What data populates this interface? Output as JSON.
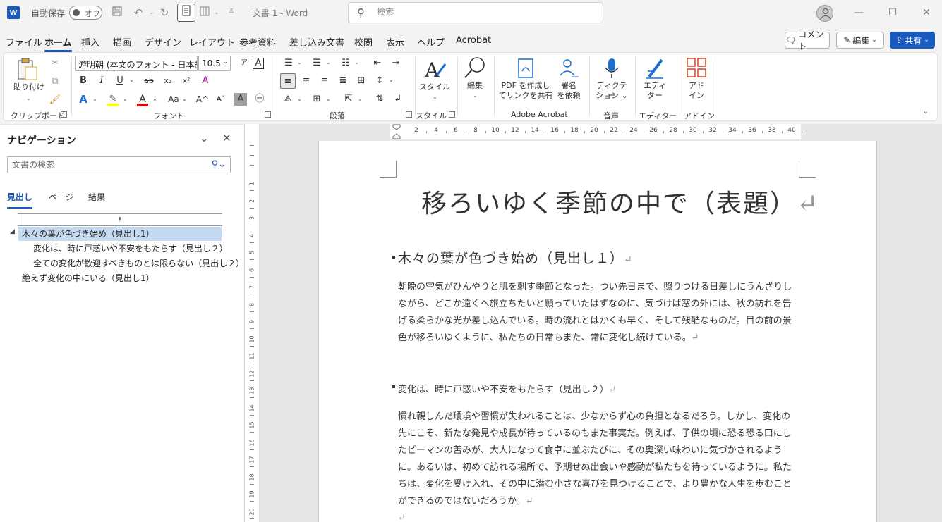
{
  "titlebar": {
    "app_icon_letter": "W",
    "autosave_label": "自動保存",
    "autosave_state": "オフ",
    "doc_title": "文書 1 - Word",
    "search_placeholder": "検索",
    "undo_icon": "undo-icon",
    "redo_icon": "redo-icon"
  },
  "menu": {
    "tabs": [
      "ファイル",
      "ホーム",
      "挿入",
      "描画",
      "デザイン",
      "レイアウト",
      "参考資料",
      "差し込み文書",
      "校閲",
      "表示",
      "ヘルプ",
      "Acrobat"
    ],
    "active": "ホーム",
    "comment_label": "コメント",
    "edit_label": "編集",
    "share_label": "共有"
  },
  "ribbon": {
    "clipboard": {
      "paste_label": "貼り付け",
      "group_label": "クリップボード"
    },
    "font": {
      "font_name": "游明朝 (本文のフォント - 日本語)",
      "font_size": "10.5",
      "group_label": "フォント",
      "bold": "B",
      "italic": "I",
      "underline": "U",
      "strike": "ab",
      "sub": "x₂",
      "sup": "x²",
      "case": "Aa",
      "grow": "A^",
      "shrink": "Aˇ"
    },
    "paragraph": {
      "group_label": "段落"
    },
    "styles": {
      "label": "スタイル",
      "group_label": "スタイル"
    },
    "editing": {
      "label": "編集"
    },
    "acrobat": {
      "pdf_label_1": "PDF を作成し",
      "pdf_label_2": "てリンクを共有",
      "sign_label_1": "署名",
      "sign_label_2": "を依頼",
      "group_label": "Adobe Acrobat"
    },
    "voice": {
      "label_1": "ディクテー",
      "label_2": "ション",
      "group_label": "音声"
    },
    "editor": {
      "label_1": "エディ",
      "label_2": "ター",
      "group_label": "エディター"
    },
    "addins": {
      "label_1": "アド",
      "label_2": "イン",
      "group_label": "アドイン"
    }
  },
  "nav": {
    "title": "ナビゲーション",
    "search_placeholder": "文書の検索",
    "tabs": [
      "見出し",
      "ページ",
      "結果"
    ],
    "active_tab": "見出し",
    "items": [
      {
        "label": "木々の葉が色づき始め（見出し1）"
      },
      {
        "label": "変化は、時に戸惑いや不安をもたらす（見出し２）"
      },
      {
        "label": "全ての変化が歓迎すべきものとは限らない（見出し２）"
      },
      {
        "label": "絶えず変化の中にいる（見出し1）"
      }
    ]
  },
  "ruler": {
    "h_numbers": [
      "2",
      "4",
      "6",
      "8",
      "10",
      "12",
      "14",
      "16",
      "18",
      "20",
      "22",
      "24",
      "26",
      "28",
      "30",
      "32",
      "34",
      "36",
      "38",
      "40"
    ],
    "v_numbers": [
      "1",
      "2",
      "3",
      "4",
      "5",
      "6",
      "7",
      "8",
      "9",
      "10",
      "11",
      "12",
      "13",
      "14",
      "15",
      "16",
      "17",
      "18",
      "19",
      "20"
    ]
  },
  "document": {
    "title": "移ろいゆく季節の中で（表題）",
    "heading1": "木々の葉が色づき始め（見出し１）",
    "para1": "朝晩の空気がひんやりと肌を刺す季節となった。つい先日まで、照りつける日差しにうんざりしながら、どこか遠くへ旅立ちたいと願っていたはずなのに、気づけば窓の外には、秋の訪れを告げる柔らかな光が差し込んでいる。時の流れとはかくも早く、そして残酷なものだ。目の前の景色が移ろいゆくように、私たちの日常もまた、常に変化し続けている。",
    "heading2": "変化は、時に戸惑いや不安をもたらす（見出し２）",
    "para2": "慣れ親しんだ環境や習慣が失われることは、少なからず心の負担となるだろう。しかし、変化の先にこそ、新たな発見や成長が待っているのもまた事実だ。例えば、子供の頃に恐る恐る口にしたピーマンの苦みが、大人になって食卓に並ぶたびに、その奥深い味わいに気づかされるように。あるいは、初めて訪れる場所で、予期せぬ出会いや感動が私たちを待っているように。私たちは、変化を受け入れ、その中に潜む小さな喜びを見つけることで、より豊かな人生を歩むことができるのではないだろうか。",
    "para_mark": "↵"
  }
}
